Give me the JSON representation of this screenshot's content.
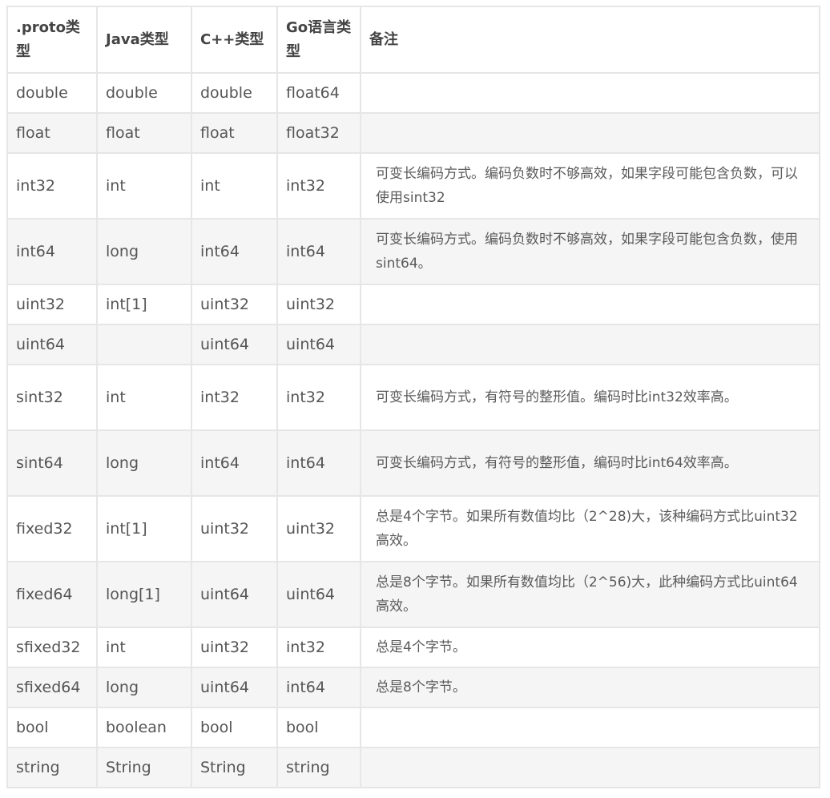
{
  "table": {
    "headers": [
      ".proto类型",
      "Java类型",
      "C++类型",
      "Go语言类型",
      "备注"
    ],
    "rows": [
      {
        "proto": "double",
        "java": "double",
        "cpp": "double",
        "go": "float64",
        "note": ""
      },
      {
        "proto": "float",
        "java": "float",
        "cpp": "float",
        "go": "float32",
        "note": ""
      },
      {
        "proto": "int32",
        "java": "int",
        "cpp": "int",
        "go": "int32",
        "note": "可变长编码方式。编码负数时不够高效，如果字段可能包含负数，可以使用sint32"
      },
      {
        "proto": "int64",
        "java": "long",
        "cpp": "int64",
        "go": "int64",
        "note": "可变长编码方式。编码负数时不够高效，如果字段可能包含负数，使用sint64。"
      },
      {
        "proto": "uint32",
        "java": "int[1]",
        "cpp": "uint32",
        "go": "uint32",
        "note": ""
      },
      {
        "proto": "uint64",
        "java": "",
        "cpp": "uint64",
        "go": "uint64",
        "note": ""
      },
      {
        "proto": "sint32",
        "java": "int",
        "cpp": "int32",
        "go": "int32",
        "note": "可变长编码方式，有符号的整形值。编码时比int32效率高。"
      },
      {
        "proto": "sint64",
        "java": "long",
        "cpp": "int64",
        "go": "int64",
        "note": "可变长编码方式，有符号的整形值，编码时比int64效率高。"
      },
      {
        "proto": "fixed32",
        "java": "int[1]",
        "cpp": "uint32",
        "go": "uint32",
        "note": "总是4个字节。如果所有数值均比（2^28)大，该种编码方式比uint32高效。"
      },
      {
        "proto": "fixed64",
        "java": "long[1]",
        "cpp": "uint64",
        "go": "uint64",
        "note": "总是8个字节。如果所有数值均比（2^56)大，此种编码方式比uint64高效。"
      },
      {
        "proto": "sfixed32",
        "java": "int",
        "cpp": "uint32",
        "go": "int32",
        "note": "总是4个字节。"
      },
      {
        "proto": "sfixed64",
        "java": "long",
        "cpp": "uint64",
        "go": "int64",
        "note": "总是8个字节。"
      },
      {
        "proto": "bool",
        "java": "boolean",
        "cpp": "bool",
        "go": "bool",
        "note": ""
      },
      {
        "proto": "string",
        "java": "String",
        "cpp": "String",
        "go": "string",
        "note": ""
      }
    ]
  }
}
